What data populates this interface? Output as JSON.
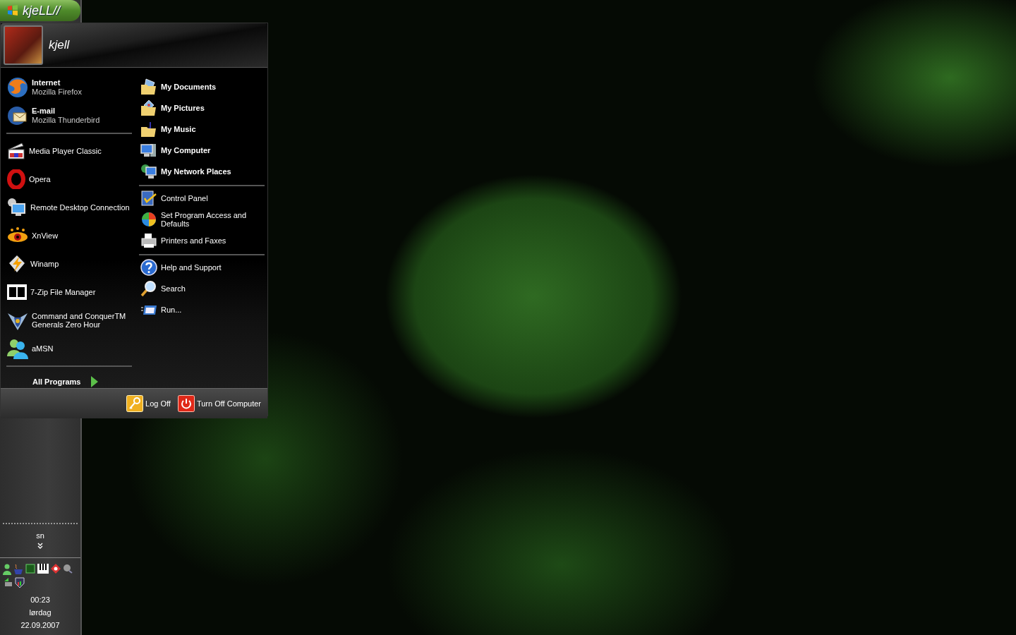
{
  "start_button": {
    "label": "kjeLL//"
  },
  "start_menu": {
    "user": {
      "name": "kjell"
    },
    "pinned": [
      {
        "title": "Internet",
        "subtitle": "Mozilla Firefox"
      },
      {
        "title": "E-mail",
        "subtitle": "Mozilla Thunderbird"
      }
    ],
    "recent": [
      {
        "label": "Media Player Classic"
      },
      {
        "label": "Opera"
      },
      {
        "label": "Remote Desktop Connection"
      },
      {
        "label": "XnView"
      },
      {
        "label": "Winamp"
      },
      {
        "label": "7-Zip File Manager"
      },
      {
        "label": "Command and ConquerTM Generals Zero Hour"
      },
      {
        "label": "aMSN"
      }
    ],
    "all_programs": "All Programs",
    "places": [
      {
        "label": "My Documents"
      },
      {
        "label": "My Pictures"
      },
      {
        "label": "My Music"
      },
      {
        "label": "My Computer"
      },
      {
        "label": "My Network Places"
      }
    ],
    "settings": [
      {
        "label": "Control Panel"
      },
      {
        "label": "Set Program Access and Defaults"
      },
      {
        "label": "Printers and Faxes"
      }
    ],
    "tools": [
      {
        "label": "Help and Support"
      },
      {
        "label": "Search"
      },
      {
        "label": "Run..."
      }
    ],
    "footer": {
      "log_off": "Log Off",
      "turn_off": "Turn Off Computer"
    }
  },
  "taskbar": {
    "toolbar_label": "sn",
    "clock": {
      "time": "00:23",
      "day": "lørdag",
      "date": "22.09.2007"
    }
  }
}
